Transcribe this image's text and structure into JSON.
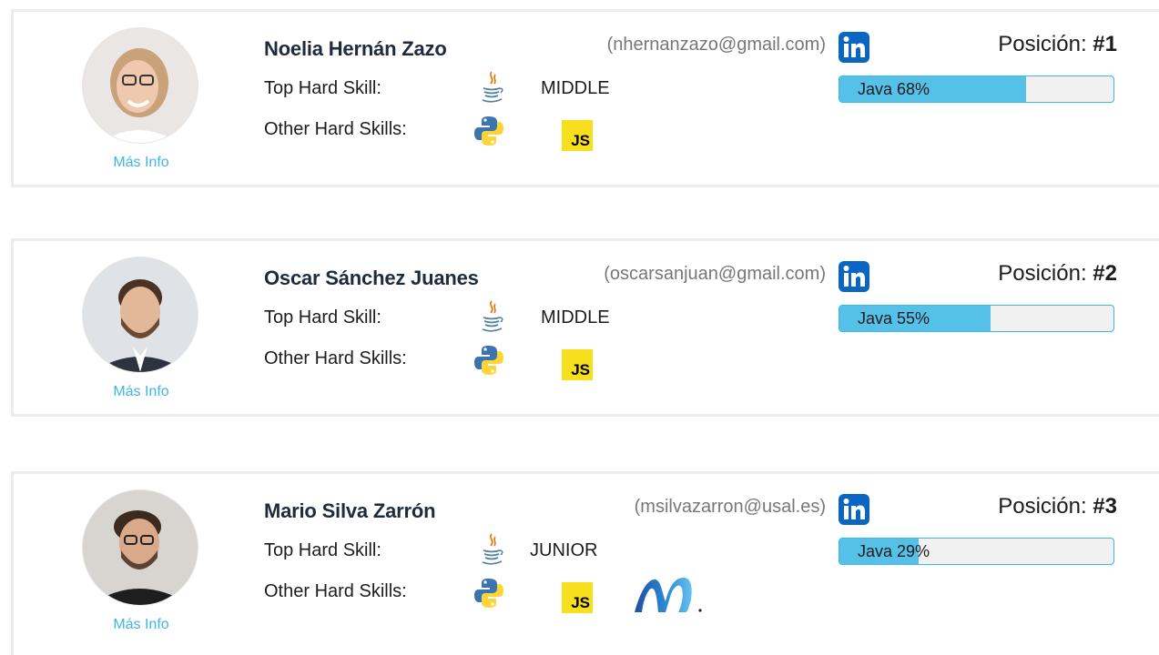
{
  "colors": {
    "accent": "#3fb6e3",
    "bar_fill": "#55c0e8",
    "linkedin": "#0a66c2",
    "js_yellow": "#f7df1e"
  },
  "candidates": [
    {
      "name": "Noelia Hernán Zazo",
      "email": "(nhernanzazo@gmail.com)",
      "top_skill_label": "Top Hard Skill:",
      "top_skill_icon": "java-icon",
      "level": "MIDDLE",
      "other_skills_label": "Other Hard Skills:",
      "other_skills_icons": [
        "python-icon",
        "javascript-icon"
      ],
      "more_info": "Más Info",
      "position_label": "Posición:",
      "position_value": "#1",
      "bar_text": "Java 68%",
      "bar_percent": 68
    },
    {
      "name": "Oscar Sánchez Juanes",
      "email": "(oscarsanjuan@gmail.com)",
      "top_skill_label": "Top Hard Skill:",
      "top_skill_icon": "java-icon",
      "level": "MIDDLE",
      "other_skills_label": "Other Hard Skills:",
      "other_skills_icons": [
        "python-icon",
        "javascript-icon"
      ],
      "more_info": "Más Info",
      "position_label": "Posición:",
      "position_value": "#2",
      "bar_text": "Java 55%",
      "bar_percent": 55
    },
    {
      "name": "Mario Silva Zarrón",
      "email": "(msilvazarron@usal.es)",
      "top_skill_label": "Top Hard Skill:",
      "top_skill_icon": "java-icon",
      "level": "JUNIOR",
      "other_skills_label": "Other Hard Skills:",
      "other_skills_icons": [
        "python-icon",
        "javascript-icon",
        "dotnet-icon"
      ],
      "more_info": "Más Info",
      "position_label": "Posición:",
      "position_value": "#3",
      "bar_text": "Java 29%",
      "bar_percent": 29
    }
  ]
}
